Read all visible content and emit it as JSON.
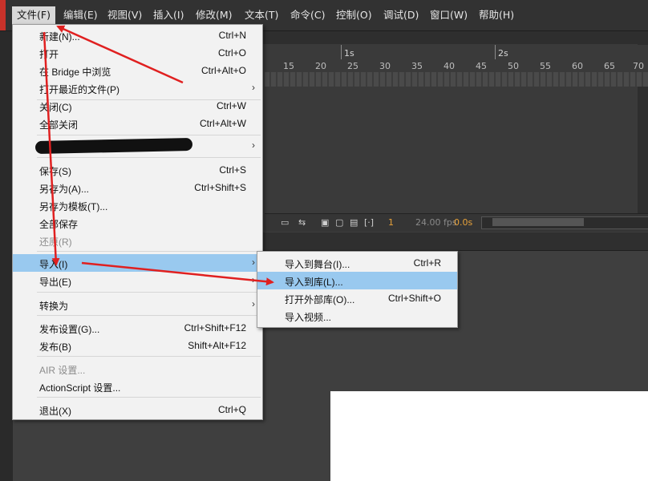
{
  "menubar": {
    "items": [
      "文件(F)",
      "编辑(E)",
      "视图(V)",
      "插入(I)",
      "修改(M)",
      "文本(T)",
      "命令(C)",
      "控制(O)",
      "调试(D)",
      "窗口(W)",
      "帮助(H)"
    ]
  },
  "timeline": {
    "seconds": [
      "1s",
      "2s"
    ],
    "ticks": [
      "15",
      "20",
      "25",
      "30",
      "35",
      "40",
      "45",
      "50",
      "55",
      "60",
      "65",
      "70"
    ],
    "frame": "1",
    "fps": "24.00 fps",
    "time": "0.0s"
  },
  "file_menu": {
    "items": [
      {
        "label": "新建(N)...",
        "shortcut": "Ctrl+N"
      },
      {
        "label": "打开",
        "shortcut": "Ctrl+O"
      },
      {
        "label": "在 Bridge 中浏览",
        "shortcut": "Ctrl+Alt+O"
      },
      {
        "label": "打开最近的文件(P)",
        "shortcut": "",
        "submenu": true
      },
      {
        "label": "关闭(C)",
        "shortcut": "Ctrl+W"
      },
      {
        "label": "全部关闭",
        "shortcut": "Ctrl+Alt+W"
      },
      {
        "label": "",
        "shortcut": "",
        "submenu": true,
        "redacted": true
      },
      {
        "label": "保存(S)",
        "shortcut": "Ctrl+S"
      },
      {
        "label": "另存为(A)...",
        "shortcut": "Ctrl+Shift+S"
      },
      {
        "label": "另存为模板(T)...",
        "shortcut": ""
      },
      {
        "label": "全部保存",
        "shortcut": ""
      },
      {
        "label": "还原(R)",
        "shortcut": "",
        "disabled": true
      },
      {
        "label": "导入(I)",
        "shortcut": "",
        "submenu": true,
        "highlighted": true
      },
      {
        "label": "导出(E)",
        "shortcut": "",
        "submenu": true
      },
      {
        "label": "转换为",
        "shortcut": "",
        "submenu": true
      },
      {
        "label": "发布设置(G)...",
        "shortcut": "Ctrl+Shift+F12"
      },
      {
        "label": "发布(B)",
        "shortcut": "Shift+Alt+F12"
      },
      {
        "label": "AIR 设置...",
        "shortcut": "",
        "disabled": true
      },
      {
        "label": "ActionScript 设置...",
        "shortcut": ""
      },
      {
        "label": "退出(X)",
        "shortcut": "Ctrl+Q"
      }
    ]
  },
  "import_menu": {
    "items": [
      {
        "label": "导入到舞台(I)...",
        "shortcut": "Ctrl+R"
      },
      {
        "label": "导入到库(L)...",
        "shortcut": "",
        "highlighted": true
      },
      {
        "label": "打开外部库(O)...",
        "shortcut": "Ctrl+Shift+O"
      },
      {
        "label": "导入视频...",
        "shortcut": ""
      }
    ]
  },
  "annotation_color": "#e02020"
}
